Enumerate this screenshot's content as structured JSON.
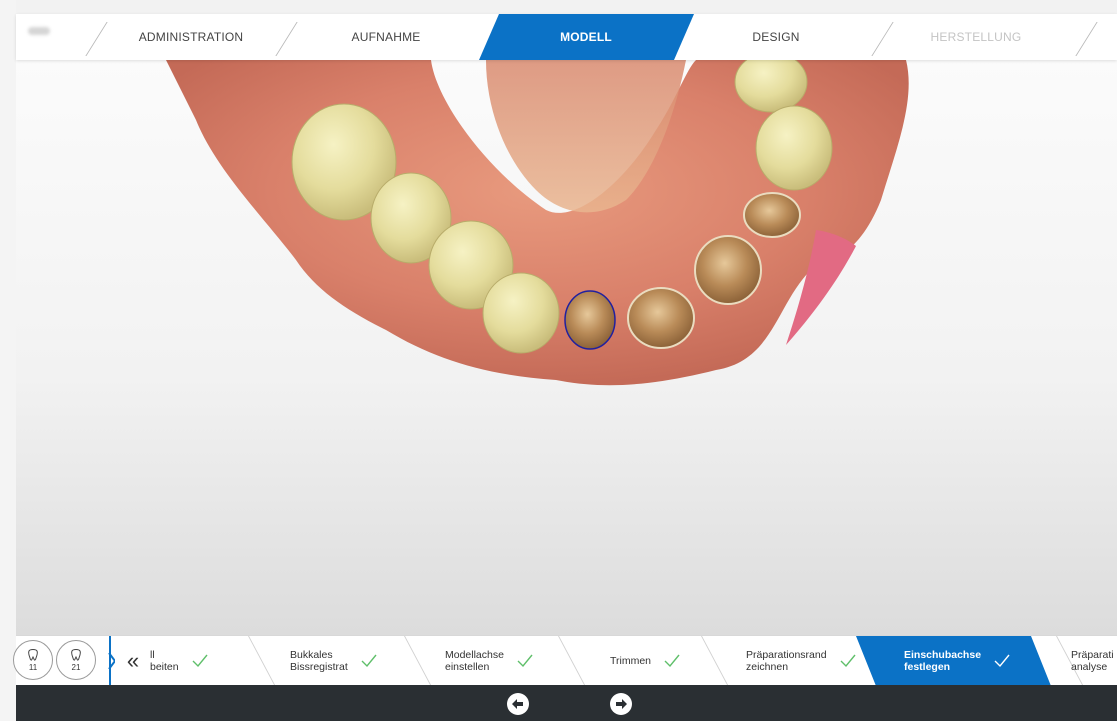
{
  "stages": [
    {
      "label": "ADMINISTRATION",
      "state": "done"
    },
    {
      "label": "AUFNAHME",
      "state": "done"
    },
    {
      "label": "MODELL",
      "state": "active"
    },
    {
      "label": "DESIGN",
      "state": "done"
    },
    {
      "label": "HERSTELLUNG",
      "state": "disabled"
    }
  ],
  "teeth": [
    {
      "number": "11"
    },
    {
      "number": "21"
    }
  ],
  "steps": [
    {
      "label": "ll\nbeiten",
      "done": true
    },
    {
      "label": "Bukkales\nBissregistrat",
      "done": true
    },
    {
      "label": "Modellachse\neinstellen",
      "done": true
    },
    {
      "label": "Trimmen",
      "done": true
    },
    {
      "label": "Präparationsrand\nzeichnen",
      "done": true
    },
    {
      "label": "Einschubachse\nfestlegen",
      "done": true
    },
    {
      "label": "Präparati\nanalyse",
      "done": false
    }
  ],
  "collapse_glyph": "«",
  "colors": {
    "accent": "#0b72c6",
    "check": "#5fbf6a",
    "footer": "#2a2f33"
  },
  "icons": [
    "tooth-icon",
    "chevron-double-left-icon",
    "check-icon",
    "arrow-left-icon",
    "arrow-right-icon"
  ]
}
